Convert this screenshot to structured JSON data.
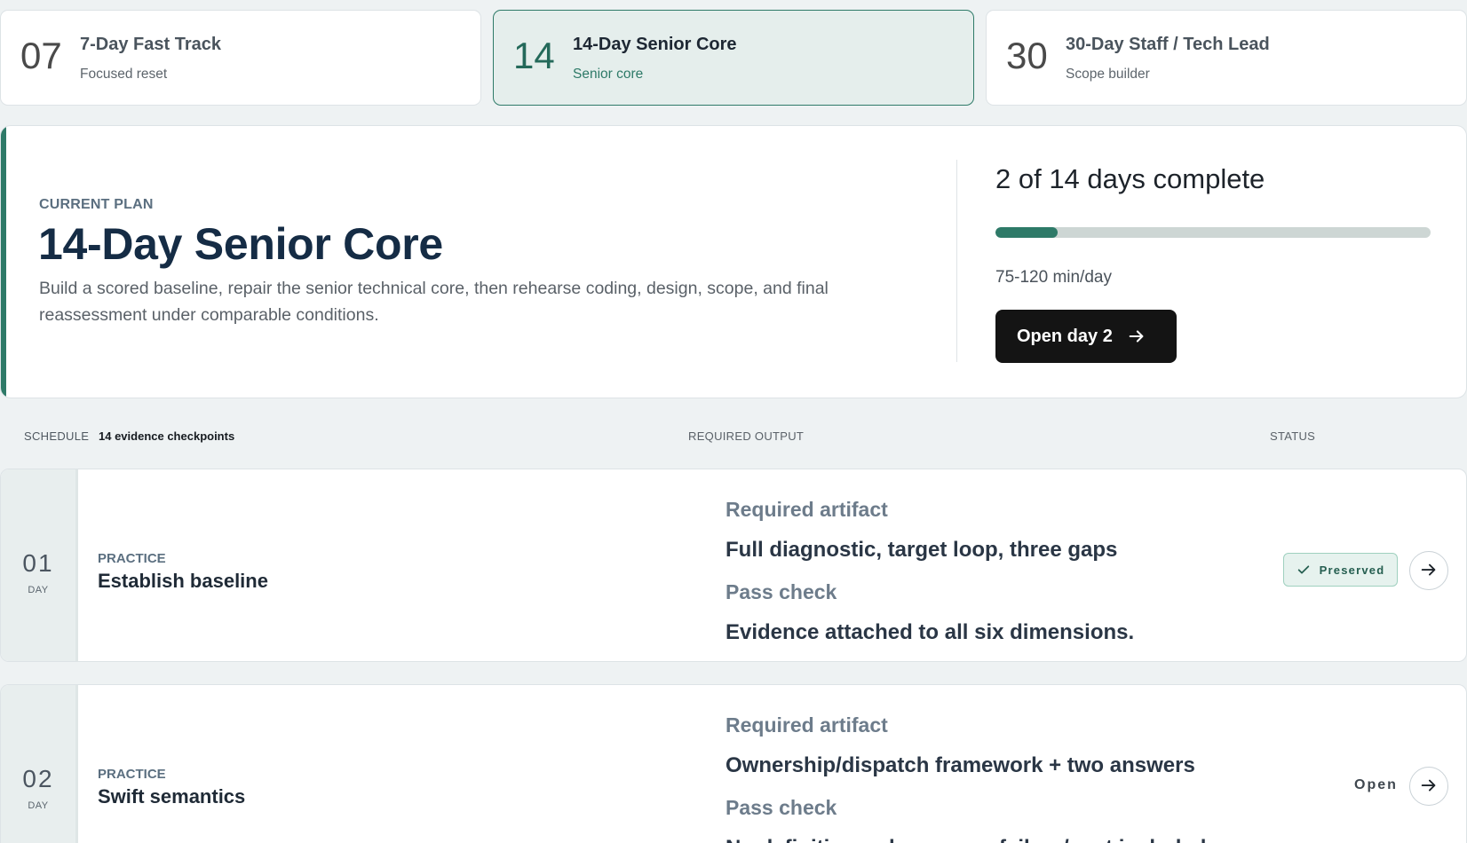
{
  "plans": [
    {
      "num": "07",
      "title": "7-Day Fast Track",
      "subtitle": "Focused reset"
    },
    {
      "num": "14",
      "title": "14-Day Senior Core",
      "subtitle": "Senior core"
    },
    {
      "num": "30",
      "title": "30-Day Staff / Tech Lead",
      "subtitle": "Scope builder"
    }
  ],
  "current": {
    "eyebrow": "CURRENT PLAN",
    "title": "14-Day Senior Core",
    "description": "Build a scored baseline, repair the senior technical core, then rehearse coding, design, scope, and final reassessment under comparable conditions.",
    "progress_text": "2 of 14 days complete",
    "progress_fraction": 0.1429,
    "duration": "75-120 min/day",
    "open_button_label": "Open day 2",
    "accent_color": "#2e7a68"
  },
  "schedule": {
    "label": "SCHEDULE",
    "count": "14 evidence checkpoints",
    "col_output": "REQUIRED OUTPUT",
    "col_status": "STATUS"
  },
  "days": [
    {
      "num": "01",
      "label": "DAY",
      "kind": "PRACTICE",
      "title": "Establish baseline",
      "artifact_heading": "Required artifact",
      "artifact": "Full diagnostic, target loop, three gaps",
      "pass_heading": "Pass check",
      "pass": "Evidence attached to all six dimensions.",
      "status": "Preserved"
    },
    {
      "num": "02",
      "label": "DAY",
      "kind": "PRACTICE",
      "title": "Swift semantics",
      "artifact_heading": "Required artifact",
      "artifact": "Ownership/dispatch framework + two answers",
      "pass_heading": "Pass check",
      "pass": "No definition-only answer; failure/cost included.",
      "status": "Open"
    }
  ]
}
